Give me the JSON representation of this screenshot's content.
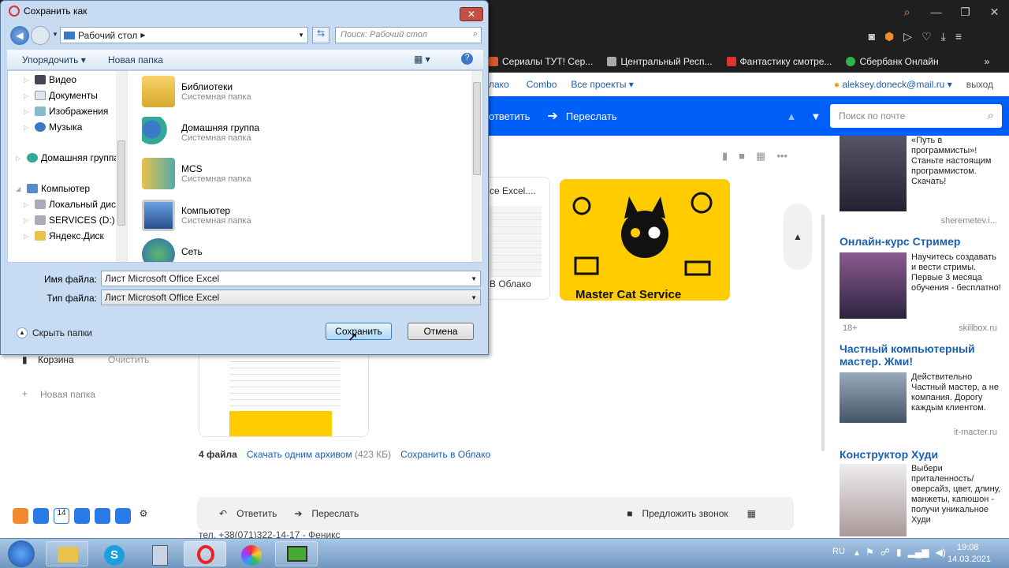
{
  "browser": {
    "bookmarks": [
      "Сериалы ТУТ! Сер...",
      "Центральный Респ...",
      "Фантастику смотре...",
      "Сбербанк Онлайн"
    ],
    "window_controls": [
      "⌕",
      "—",
      "❐",
      "✕"
    ]
  },
  "mail_nav": {
    "links": [
      "лако",
      "Combo",
      "Все проекты ▾"
    ],
    "user": "aleksey.doneck@mail.ru ▾",
    "logout": "выход"
  },
  "toolbar": {
    "reply": "ответить",
    "forward": "Переслать"
  },
  "search": {
    "placeholder": "Поиск по почте"
  },
  "attachments": {
    "file1_name": "ce Excel....",
    "file1_caption": "В Облако",
    "count": "4 файла",
    "download_all": "Скачать одним архивом",
    "size": "(423 КБ)",
    "save_cloud": "Сохранить в Облако",
    "brand": "Master Cat Service"
  },
  "left_pane": {
    "trash": "Корзина",
    "clear": "Очистить",
    "new_folder": "Новая папка"
  },
  "bottom_bar": {
    "reply": "Ответить",
    "forward": "Переслать",
    "call": "Предложить звонок",
    "footer_text": "тел. +38(071)322-14-17 - Феникс"
  },
  "ads": [
    {
      "title": "",
      "text": "«Путь в программисты»! Станьте настоящим программистом. Скачать!",
      "source": "sheremetev.i..."
    },
    {
      "title": "Онлайн-курс Стример",
      "text": "Научитесь создавать и вести стримы. Первые 3 месяца обучения - бесплатно!",
      "source": "skillbox.ru",
      "age": "18+"
    },
    {
      "title": "Частный компьютерный мастер. Жми!",
      "text": "Действительно Частный мастер, а не компания. Дорогу каждым клиентом.",
      "source": "it-macter.ru"
    },
    {
      "title": "Конструктор Худи",
      "text": "Выбери приталенность/ оверсайз, цвет, длину, манжеты, капюшон - получи уникальное Худи",
      "source": ""
    }
  ],
  "dialog": {
    "title": "Сохранить как",
    "address": "Рабочий стол",
    "search_placeholder": "Поиск: Рабочий стол",
    "organize": "Упорядочить ▾",
    "new_folder": "Новая папка",
    "tree": [
      "Видео",
      "Документы",
      "Изображения",
      "Музыка",
      "Домашняя группа",
      "Компьютер",
      "Локальный диск",
      "SERVICES (D:)",
      "Яндекс.Диск"
    ],
    "files": [
      {
        "name": "Библиотеки",
        "sub": "Системная папка"
      },
      {
        "name": "Домашняя группа",
        "sub": "Системная папка"
      },
      {
        "name": "MCS",
        "sub": "Системная папка"
      },
      {
        "name": "Компьютер",
        "sub": "Системная папка"
      },
      {
        "name": "Сеть",
        "sub": ""
      }
    ],
    "filename_label": "Имя файла:",
    "filename_value": "Лист Microsoft Office Excel",
    "filetype_label": "Тип файла:",
    "filetype_value": "Лист Microsoft Office Excel",
    "hide_folders": "Скрыть папки",
    "save": "Сохранить",
    "cancel": "Отмена"
  },
  "taskbar": {
    "lang": "RU",
    "time": "19:08",
    "date": "14.03.2021"
  },
  "colors": {
    "mail_blue": "#005ff9",
    "dialog_bg": "#c7dbf2",
    "taskbar": "#8db2d8",
    "ad_title": "#1a5fb4",
    "cat_yellow": "#ffcc00"
  }
}
